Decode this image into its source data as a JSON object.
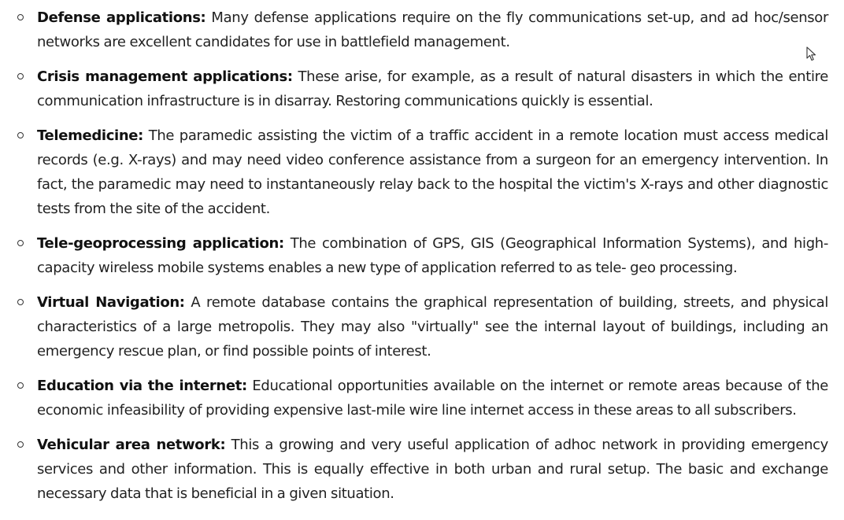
{
  "items": [
    {
      "term": "Defense applications:",
      "text": " Many defense applications require on the fly communications set-up, and ad hoc/sensor networks are excellent candidates for use in battlefield management."
    },
    {
      "term": "Crisis management applications:",
      "text": " These arise, for example, as a result of natural disasters in which the entire communication infrastructure is in disarray. Restoring communications quickly is essential."
    },
    {
      "term": "Telemedicine:",
      "text": " The paramedic assisting the victim of a traffic accident in a remote location must access medical records (e.g. X-rays) and may need video conference assistance from a surgeon for an emergency intervention. In fact, the paramedic may need to instantaneously relay back to the hospital the victim's X-rays and other diagnostic tests from the site of the accident."
    },
    {
      "term": "Tele-geoprocessing application:",
      "text": " The combination of GPS, GIS (Geographical Information Systems), and high-capacity wireless mobile systems enables a new type of application referred to as tele- geo processing."
    },
    {
      "term": "Virtual Navigation:",
      "text": " A remote database contains the graphical representation of building, streets, and physical characteristics of a large metropolis. They may also \"virtually\" see the internal layout of buildings, including an emergency rescue plan, or find possible points of interest."
    },
    {
      "term": "Education via the internet:",
      "text": " Educational opportunities available on the internet or remote areas because of the economic infeasibility of providing expensive last-mile wire line internet access in these areas to all subscribers."
    },
    {
      "term": "Vehicular area network:",
      "text": " This a growing and very useful application of adhoc network in providing emergency services and other information. This is equally effective in both urban and rural setup. The basic and exchange necessary data that is beneficial in a given situation."
    }
  ],
  "icons": {
    "bullet": "hollow-circle-bullet",
    "cursor": "mouse-pointer-icon"
  }
}
